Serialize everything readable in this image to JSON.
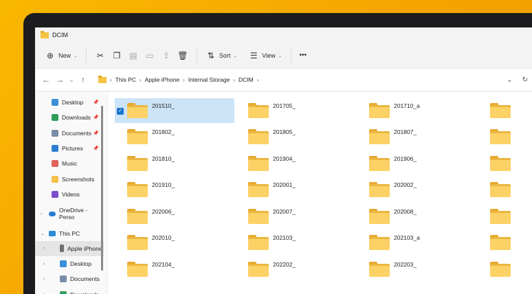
{
  "window": {
    "title": "DCIM"
  },
  "toolbar": {
    "new_label": "New",
    "sort_label": "Sort",
    "view_label": "View",
    "more_label": "•••"
  },
  "nav": {
    "breadcrumbs": [
      "This PC",
      "Apple iPhone",
      "Internal Storage",
      "DCIM"
    ]
  },
  "sidebar": {
    "quick": [
      {
        "label": "Desktop",
        "pinned": true,
        "color": "#3a8fd9"
      },
      {
        "label": "Downloads",
        "pinned": true,
        "color": "#2f9e5a"
      },
      {
        "label": "Documents",
        "pinned": true,
        "color": "#7a8da8"
      },
      {
        "label": "Pictures",
        "pinned": true,
        "color": "#2d7fd3"
      },
      {
        "label": "Music",
        "pinned": false,
        "color": "#e0635a"
      },
      {
        "label": "Screenshots",
        "pinned": false,
        "color": "#f3c04a"
      },
      {
        "label": "Videos",
        "pinned": false,
        "color": "#7a4fc9"
      }
    ],
    "onedrive": "OneDrive - Perso",
    "thispc": "This PC",
    "devices": [
      "Apple iPhone",
      "Desktop",
      "Documents",
      "Downloads"
    ]
  },
  "files": [
    "201510_",
    "201705_",
    "201710_a",
    "",
    "201802_",
    "201805_",
    "201807_",
    "",
    "201810_",
    "201904_",
    "201906_",
    "",
    "201910_",
    "202001_",
    "202002_",
    "",
    "202006_",
    "202007_",
    "202008_",
    "",
    "202010_",
    "202103_",
    "202103_a",
    "",
    "202104_",
    "202202_",
    "202203_",
    ""
  ],
  "selected_file": "201510_"
}
